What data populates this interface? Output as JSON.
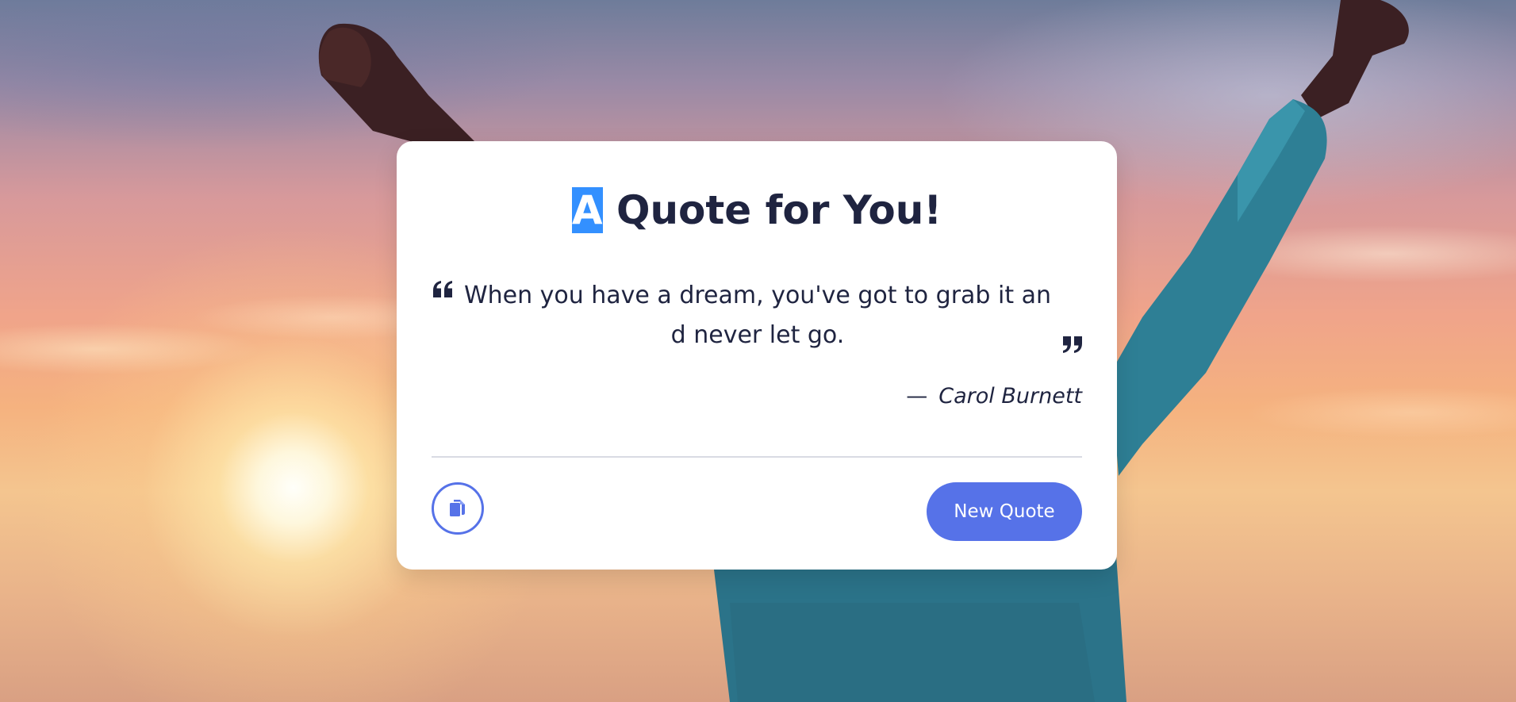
{
  "card": {
    "title_highlight": "A",
    "title_rest": " Quote for You!",
    "quote": "When you have a dream, you've got to grab it and never let go.",
    "author_dash": "—",
    "author": "Carol Burnett",
    "new_quote_label": "New Quote"
  },
  "icons": {
    "open_quote": "quote-left-icon",
    "close_quote": "quote-right-icon",
    "copy": "copy-icon"
  },
  "colors": {
    "accent": "#5672e8",
    "text": "#1f2440",
    "selection": "#3390ff",
    "card": "#ffffff"
  }
}
